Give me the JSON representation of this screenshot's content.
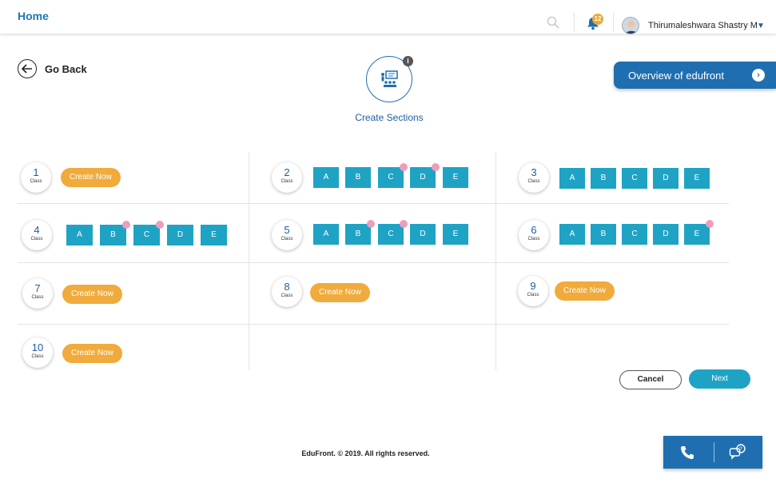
{
  "header": {
    "home_label": "Home",
    "notification_count": "12",
    "user_name": "Thirumaleshwara Shastry M"
  },
  "nav": {
    "go_back_label": "Go Back"
  },
  "page": {
    "title": "Create Sections",
    "info_label": "i"
  },
  "overview": {
    "label": "Overview of edufront",
    "chevron": "›"
  },
  "class_label": "Class",
  "create_now_label": "Create Now",
  "classes": [
    {
      "number": "1"
    },
    {
      "number": "2",
      "sections": [
        "A",
        "B",
        "C",
        "D",
        "E"
      ]
    },
    {
      "number": "3",
      "sections": [
        "A",
        "B",
        "C",
        "D",
        "E"
      ]
    },
    {
      "number": "4",
      "sections": [
        "A",
        "B",
        "C",
        "D",
        "E"
      ]
    },
    {
      "number": "5",
      "sections": [
        "A",
        "B",
        "C",
        "D",
        "E"
      ]
    },
    {
      "number": "6",
      "sections": [
        "A",
        "B",
        "C",
        "D",
        "E"
      ]
    },
    {
      "number": "7"
    },
    {
      "number": "8"
    },
    {
      "number": "9"
    },
    {
      "number": "10"
    }
  ],
  "actions": {
    "cancel_label": "Cancel",
    "next_label": "Next"
  },
  "footer": {
    "copyright": "EduFront. © 2019. All rights reserved."
  },
  "colors": {
    "primary": "#1f6fb0",
    "section_box": "#1fa3c4",
    "create_now": "#f0ab3c",
    "marker": "#ef9cc0"
  },
  "icons": [
    "search-icon",
    "bell-icon",
    "avatar",
    "caret-down-icon",
    "arrow-left-icon",
    "classroom-icon",
    "info-icon",
    "chevron-right-icon",
    "phone-icon",
    "chat-icon"
  ]
}
